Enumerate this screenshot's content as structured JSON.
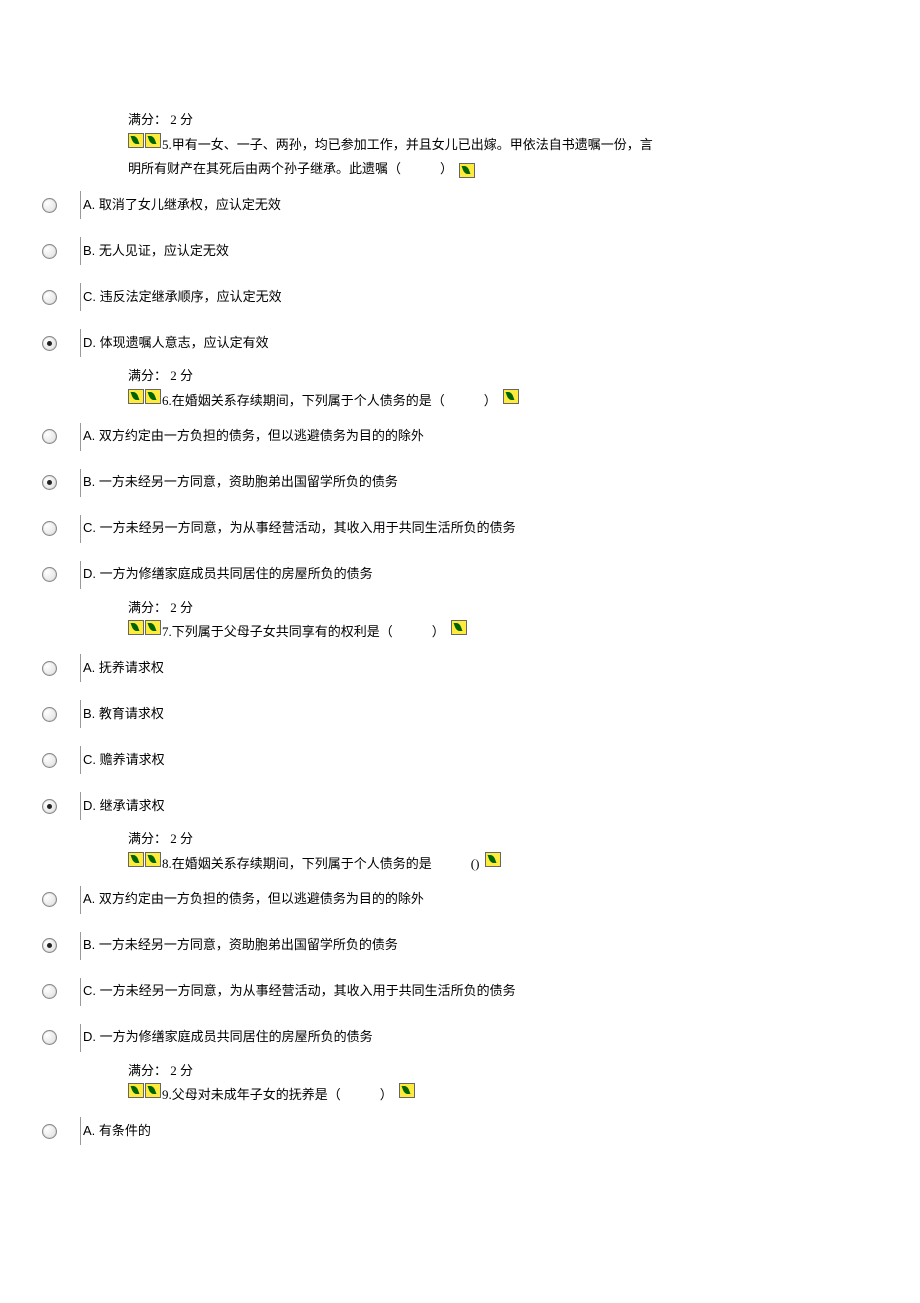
{
  "score_label": "满分： 2  分",
  "questions": [
    {
      "num": "5.",
      "text_line1": "甲有一女、一子、两孙，均已参加工作，并且女儿已出嫁。甲依法自书遗嘱一份，言",
      "text_line2": "明所有财产在其死后由两个孙子继承。此遗嘱（　　　）",
      "twoLine": true,
      "options": [
        {
          "letter": "A.",
          "text": "取消了女儿继承权，应认定无效",
          "selected": false
        },
        {
          "letter": "B.",
          "text": "无人见证，应认定无效",
          "selected": false
        },
        {
          "letter": "C.",
          "text": "违反法定继承顺序，应认定无效",
          "selected": false
        },
        {
          "letter": "D.",
          "text": "体现遗嘱人意志，应认定有效",
          "selected": true
        }
      ]
    },
    {
      "num": "6.",
      "text_line1": "在婚姻关系存续期间，下列属于个人债务的是（　　　）",
      "options": [
        {
          "letter": "A.",
          "text": "双方约定由一方负担的债务，但以逃避债务为目的的除外",
          "selected": false
        },
        {
          "letter": "B.",
          "text": "一方未经另一方同意，资助胞弟出国留学所负的债务",
          "selected": true
        },
        {
          "letter": "C.",
          "text": "一方未经另一方同意，为从事经营活动，其收入用于共同生活所负的债务",
          "selected": false
        },
        {
          "letter": "D.",
          "text": " 一方为修缮家庭成员共同居住的房屋所负的债务",
          "selected": false
        }
      ]
    },
    {
      "num": "7.",
      "text_line1": "下列属于父母子女共同享有的权利是（　　　）",
      "options": [
        {
          "letter": "A.",
          "text": "抚养请求权",
          "selected": false
        },
        {
          "letter": "B.",
          "text": "教育请求权",
          "selected": false
        },
        {
          "letter": "C.",
          "text": "赡养请求权",
          "selected": false
        },
        {
          "letter": "D.",
          "text": "继承请求权",
          "selected": true
        }
      ]
    },
    {
      "num": "8.",
      "text_line1": "在婚姻关系存续期间，下列属于个人债务的是　　　()",
      "options": [
        {
          "letter": "A.",
          "text": "双方约定由一方负担的债务，但以逃避债务为目的的除外",
          "selected": false
        },
        {
          "letter": "B.",
          "text": "一方未经另一方同意，资助胞弟出国留学所负的债务",
          "selected": true
        },
        {
          "letter": "C.",
          "text": "一方未经另一方同意，为从事经营活动，其收入用于共同生活所负的债务",
          "selected": false
        },
        {
          "letter": "D.",
          "text": " 一方为修缮家庭成员共同居住的房屋所负的债务",
          "selected": false
        }
      ]
    },
    {
      "num": "9.",
      "text_line1": "父母对未成年子女的抚养是（　　　）",
      "options": [
        {
          "letter": "A.",
          "text": "有条件的",
          "selected": false
        }
      ]
    }
  ]
}
